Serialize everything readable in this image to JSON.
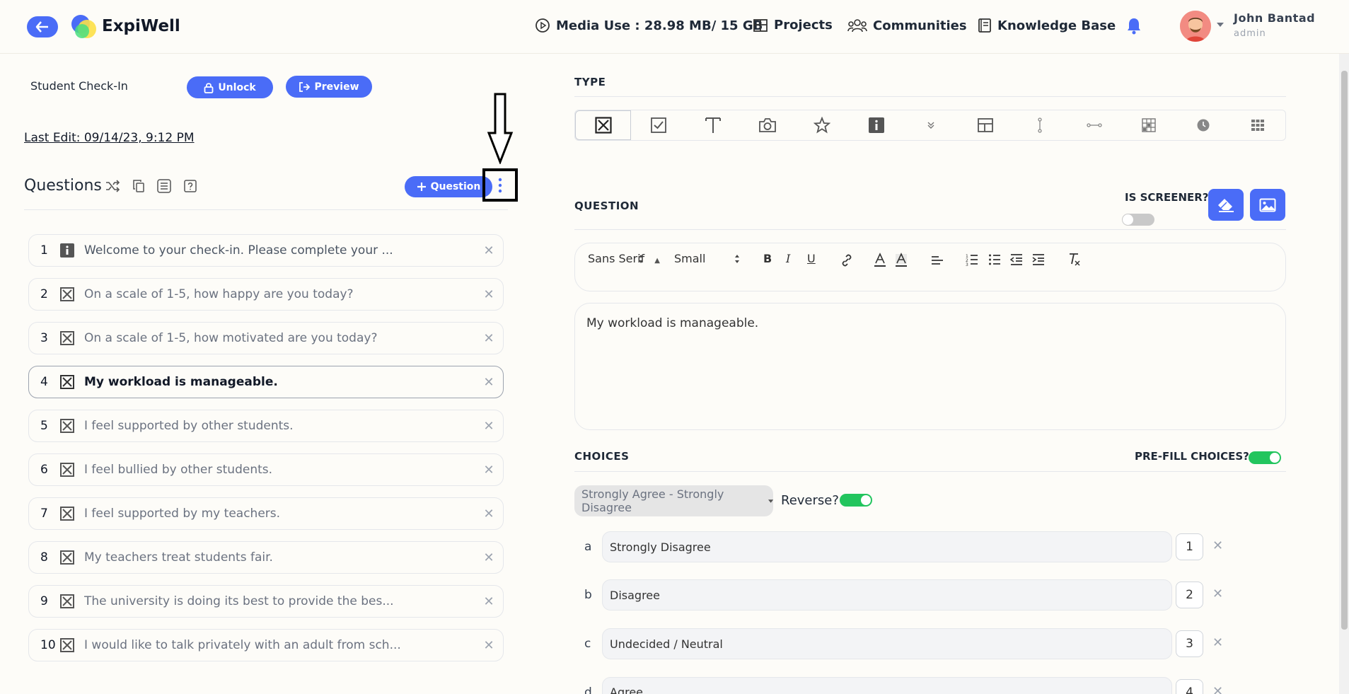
{
  "header": {
    "brand": "ExpiWell",
    "media_use": "Media Use : 28.98 MB/ 15 GB",
    "projects": "Projects",
    "communities": "Communities",
    "knowledge_base": "Knowledge Base",
    "user_name": "John Bantad",
    "user_role": "admin"
  },
  "survey": {
    "title": "Student Check-In",
    "unlock_label": "Unlock",
    "preview_label": "Preview",
    "last_edit": "Last Edit: 09/14/23, 9:12 PM"
  },
  "questions": {
    "heading": "Questions",
    "add_label": "Question",
    "items": [
      {
        "num": "1",
        "text": "Welcome to your check-in. Please complete your ...",
        "type": "info"
      },
      {
        "num": "2",
        "text": "On a scale of 1-5, how happy are you today?",
        "type": "choice"
      },
      {
        "num": "3",
        "text": "On a scale of 1-5, how motivated are you today?",
        "type": "choice"
      },
      {
        "num": "4",
        "text": "My workload is manageable.",
        "type": "choice"
      },
      {
        "num": "5",
        "text": "I feel supported by other students.",
        "type": "choice"
      },
      {
        "num": "6",
        "text": "I feel bullied by other students.",
        "type": "choice"
      },
      {
        "num": "7",
        "text": "I feel supported by my teachers.",
        "type": "choice"
      },
      {
        "num": "8",
        "text": "My teachers treat students fair.",
        "type": "choice"
      },
      {
        "num": "9",
        "text": "The university is doing its best to provide the bes...",
        "type": "choice"
      },
      {
        "num": "10",
        "text": "I would like to talk privately with an adult from sch...",
        "type": "choice"
      }
    ]
  },
  "editor": {
    "type_label": "TYPE",
    "question_label": "QUESTION",
    "screener_label": "IS SCREENER?",
    "font_family": "Sans Serif",
    "font_size": "Small",
    "bold": "B",
    "italic": "I",
    "underline": "U",
    "question_text": "My workload is manageable.",
    "choices_label": "CHOICES",
    "prefill_label": "PRE-FILL CHOICES?",
    "scale_select": "Strongly Agree - Strongly Disagree",
    "reverse_label": "Reverse?",
    "choices": [
      {
        "letter": "a",
        "text": "Strongly Disagree",
        "value": "1"
      },
      {
        "letter": "b",
        "text": "Disagree",
        "value": "2"
      },
      {
        "letter": "c",
        "text": "Undecided / Neutral",
        "value": "3"
      },
      {
        "letter": "d",
        "text": "Agree",
        "value": "4"
      }
    ]
  },
  "colors": {
    "accent": "#4a6cf7",
    "toggle_on": "#22c55e",
    "background": "#fdfcf8"
  }
}
